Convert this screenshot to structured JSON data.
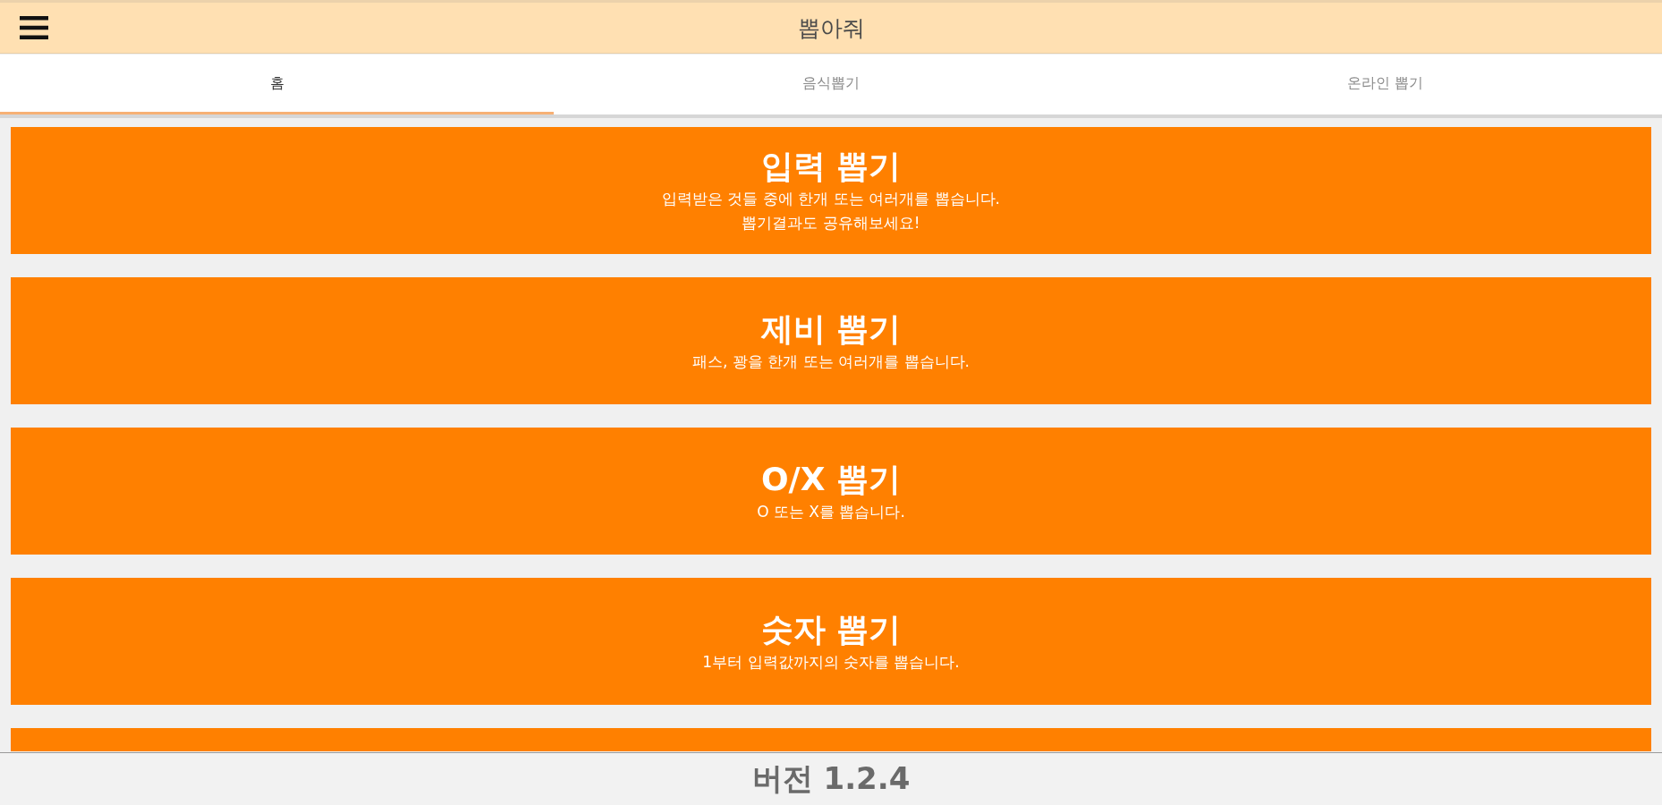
{
  "app_bar": {
    "title": "뽑아줘"
  },
  "tabs": [
    {
      "label": "홈",
      "selected": true
    },
    {
      "label": "음식뽑기",
      "selected": false
    },
    {
      "label": "온라인 뽑기",
      "selected": false
    }
  ],
  "cards": [
    {
      "title": "입력 뽑기",
      "description": [
        "입력받은 것들 중에 한개 또는 여러개를 뽑습니다.",
        "뽑기결과도 공유해보세요!"
      ],
      "cut_off": false
    },
    {
      "title": "제비 뽑기",
      "description": [
        "패스, 꽝을 한개 또는 여러개를 뽑습니다."
      ],
      "cut_off": false
    },
    {
      "title": "O/X 뽑기",
      "description": [
        "O 또는 X를 뽑습니다."
      ],
      "cut_off": false
    },
    {
      "title": "숫자 뽑기",
      "description": [
        "1부터 입력값까지의 숫자를 뽑습니다."
      ],
      "cut_off": false
    },
    {
      "cut_off": true
    }
  ],
  "footer": {
    "version": "버전 1.2.4"
  }
}
